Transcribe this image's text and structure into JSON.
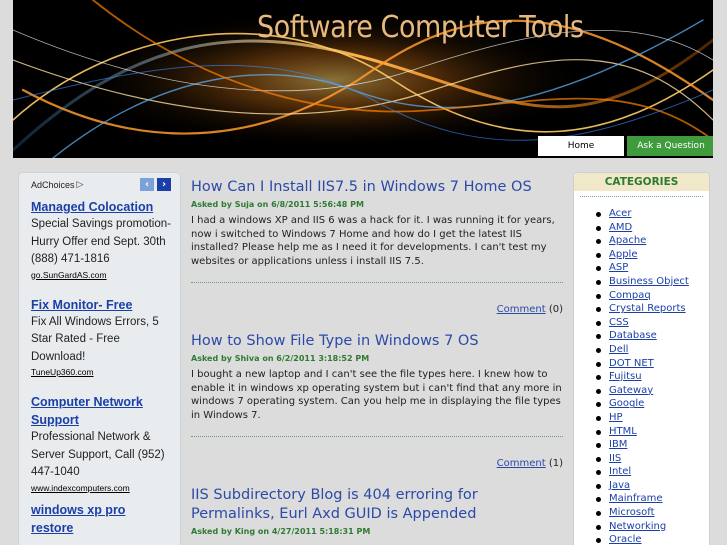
{
  "header": {
    "site_title": "Software Computer Tools",
    "nav": {
      "home": "Home",
      "ask": "Ask a Question"
    }
  },
  "ads": {
    "adchoices": "AdChoices",
    "prev_icon": "‹",
    "next_icon": "›",
    "items": [
      {
        "title": "Managed Colocation",
        "desc": "Special Savings promotion- Hurry Offer end Sept. 30th (888) 471-1816",
        "url": "go.SunGardAS.com"
      },
      {
        "title": "Fix Monitor- Free",
        "desc": "Fix All Windows Errors, 5 Star Rated - Free Download!",
        "url": "TuneUp360.com"
      },
      {
        "title": "Computer Network Support",
        "desc": "Professional Network & Server Support, Call (952) 447-1040",
        "url": "www.indexcomputers.com"
      },
      {
        "title": "windows xp pro restore",
        "desc": "",
        "url": ""
      }
    ]
  },
  "posts": [
    {
      "title": "How Can I Install IIS7.5 in Windows 7 Home OS",
      "meta": "Asked by Suja on 6/8/2011 5:56:48 PM",
      "body": "I had a windows XP and IIS 6 was a hack for it. I was running it for years, now i switched to Windows 7 Home and how do I get the latest IIS installed? Please help me as I need it for developments. I can't test my websites or applications unless i install IIS 7.5.",
      "comment_label": "Comment",
      "comment_count": "(0)"
    },
    {
      "title": "How to Show File Type in Windows 7 OS",
      "meta": "Asked by Shiva on 6/2/2011 3:18:52 PM",
      "body": "I bought a new laptop and I can't see the file types here. I knew how to enable it in windows xp operating system but i can't find that any more in windows 7 operating system. Can you help me in displaying the file types in Windows 7.",
      "comment_label": "Comment",
      "comment_count": "(1)"
    },
    {
      "title": "IIS Subdirectory Blog is 404 erroring for Permalinks, Eurl Axd GUID is Appended",
      "meta": "Asked by King on 4/27/2011 5:18:31 PM",
      "body": "",
      "comment_label": "",
      "comment_count": ""
    }
  ],
  "categories": {
    "header": "CATEGORIES",
    "items": [
      "Acer",
      "AMD",
      "Apache",
      "Apple",
      "ASP",
      "Business Object",
      "Compaq",
      "Crystal Reports",
      "CSS",
      "Database",
      "Dell",
      "DOT NET",
      "Fujitsu",
      "Gateway",
      "Google",
      "HP",
      "HTML",
      "IBM",
      "IIS",
      "Intel",
      "Java",
      "Mainframe",
      "Microsoft",
      "Networking",
      "Oracle"
    ]
  },
  "colors": {
    "link_blue": "#1a3fa8",
    "meta_green": "#2f7b33",
    "ask_button": "#3f9b3b",
    "title_gold": "#e8b97c"
  }
}
